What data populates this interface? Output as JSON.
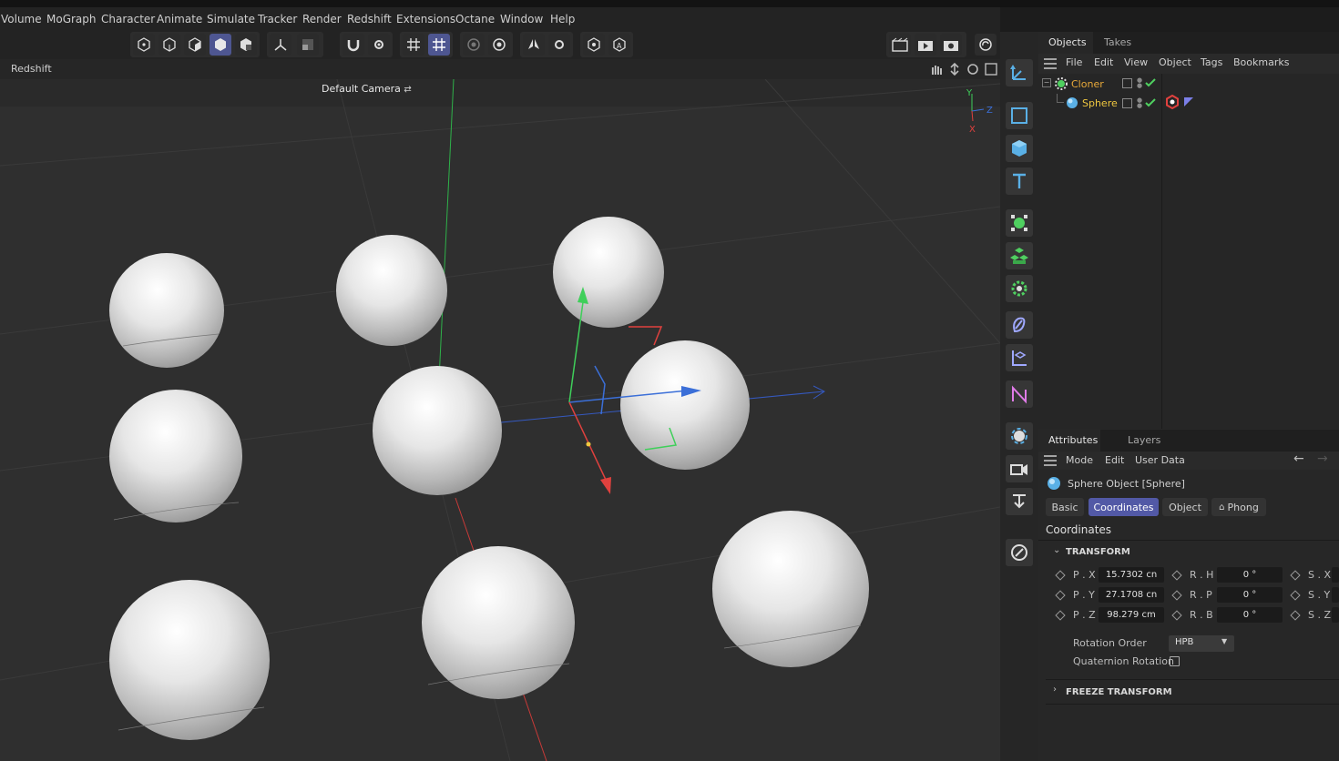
{
  "menu": [
    "Volume",
    "MoGraph",
    "Character",
    "Animate",
    "Simulate",
    "Tracker",
    "Render",
    "Redshift",
    "Extensions",
    "Octane",
    "Window",
    "Help"
  ],
  "viewport": {
    "renderer_label": "Redshift",
    "camera_label": "Default Camera",
    "camera_icon": "camera-link-icon"
  },
  "objects_panel": {
    "tabs": [
      "Objects",
      "Takes"
    ],
    "menu": [
      "File",
      "Edit",
      "View",
      "Object",
      "Tags",
      "Bookmarks"
    ],
    "items": [
      {
        "name": "Cloner",
        "color": "#e8a93a",
        "icon": "cloner-icon"
      },
      {
        "name": "Sphere",
        "color": "#f0c840",
        "icon": "sphere-icon"
      }
    ]
  },
  "attributes_panel": {
    "tabs": [
      "Attributes",
      "Layers"
    ],
    "menu": [
      "Mode",
      "Edit",
      "User Data"
    ],
    "object_title": "Sphere Object [Sphere]",
    "subtabs": [
      "Basic",
      "Coordinates",
      "Object",
      "Phong"
    ],
    "active_subtab": "Coordinates",
    "section_title": "Coordinates",
    "transform_header": "TRANSFORM",
    "fields": {
      "px_label": "P . X",
      "px_value": "15.7302 cn",
      "py_label": "P . Y",
      "py_value": "27.1708 cn",
      "pz_label": "P . Z",
      "pz_value": "98.279 cm",
      "rh_label": "R . H",
      "rh_value": "0 °",
      "rp_label": "R . P",
      "rp_value": "0 °",
      "rb_label": "R . B",
      "rb_value": "0 °",
      "sx_label": "S . X",
      "sy_label": "S . Y",
      "sz_label": "S . Z"
    },
    "rotation_order_label": "Rotation Order",
    "rotation_order_value": "HPB",
    "quaternion_label": "Quaternion Rotation",
    "freeze_header": "FREEZE TRANSFORM"
  },
  "axis_labels": {
    "y": "Y",
    "z": "Z",
    "x": "X"
  },
  "colors": {
    "accent": "#5259a6",
    "x_axis": "#e0413e",
    "y_axis": "#3fcf5a",
    "z_axis": "#3b6fd8"
  }
}
